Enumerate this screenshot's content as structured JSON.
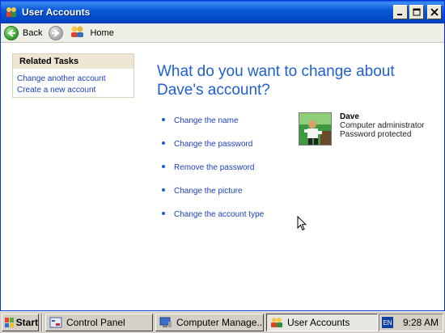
{
  "window": {
    "title": "User Accounts",
    "controls": {
      "minimize": "_",
      "maximize": "□",
      "close": "X"
    }
  },
  "toolbar": {
    "back_label": "Back",
    "home_label": "Home",
    "icons": {
      "back": "back-arrow-icon",
      "forward": "forward-arrow-icon",
      "home": "users-home-icon"
    }
  },
  "related_tasks": {
    "header": "Related Tasks",
    "links": [
      "Change another account",
      "Create a new account"
    ]
  },
  "main": {
    "heading_line1": "What do you want to change about",
    "heading_line2": "Dave's account?",
    "options": [
      "Change the name",
      "Change the password",
      "Remove the password",
      "Change the picture",
      "Change the account type"
    ]
  },
  "account": {
    "name": "Dave",
    "type": "Computer administrator",
    "status": "Password protected"
  },
  "taskbar": {
    "start_label": "Start",
    "tasks": [
      {
        "label": "Control Panel",
        "icon": "control-panel-icon"
      },
      {
        "label": "Computer Manage...",
        "icon": "computer-management-icon"
      },
      {
        "label": "User Accounts",
        "icon": "user-accounts-icon"
      }
    ],
    "language": "EN",
    "clock": "9:28 AM"
  },
  "colors": {
    "titlebar": "#0b5ad8",
    "link": "#1c3fbd",
    "heading": "#1f5fd0",
    "taskpane_header": "#ece6d2"
  }
}
